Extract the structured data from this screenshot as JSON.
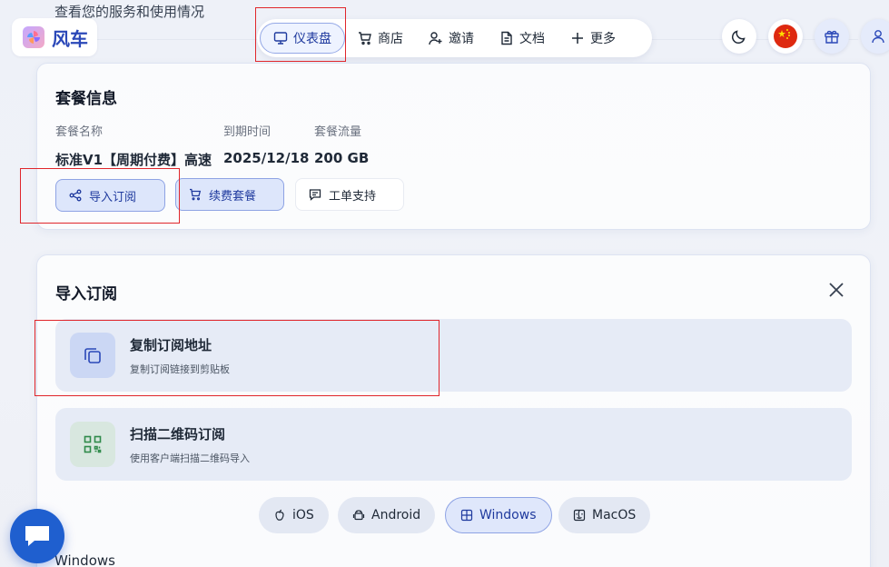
{
  "page_subtitle": "查看您的服务和使用情况",
  "brand": {
    "name": "风车"
  },
  "nav": {
    "items": [
      {
        "label": "仪表盘",
        "icon": "monitor-icon",
        "active": true
      },
      {
        "label": "商店",
        "icon": "cart-icon"
      },
      {
        "label": "邀请",
        "icon": "user-plus-icon"
      },
      {
        "label": "文档",
        "icon": "document-icon"
      },
      {
        "label": "更多",
        "icon": "plus-icon"
      }
    ]
  },
  "header_actions": [
    "moon-icon",
    "china-flag-icon",
    "gift-icon",
    "user-icon"
  ],
  "plan": {
    "title": "套餐信息",
    "name_label": "套餐名称",
    "name_value": "标准V1【周期付费】高速",
    "expiry_label": "到期时间",
    "expiry_value": "2025/12/18",
    "traffic_label": "套餐流量",
    "traffic_value": "200 GB",
    "buttons": {
      "import": "导入订阅",
      "renew": "续费套餐",
      "ticket": "工单支持"
    }
  },
  "import_panel": {
    "title": "导入订阅",
    "options": [
      {
        "title": "复制订阅地址",
        "subtitle": "复制订阅链接到剪贴板"
      },
      {
        "title": "扫描二维码订阅",
        "subtitle": "使用客户端扫描二维码导入"
      }
    ],
    "platforms": [
      {
        "label": "iOS",
        "icon": "apple-icon"
      },
      {
        "label": "Android",
        "icon": "android-icon"
      },
      {
        "label": "Windows",
        "icon": "windows-icon",
        "active": true
      },
      {
        "label": "MacOS",
        "icon": "macos-icon"
      }
    ],
    "section_label": "Windows"
  },
  "colors": {
    "accent": "#1f3a9e",
    "highlight": "#e0262b",
    "fab": "#1f5fcf"
  }
}
